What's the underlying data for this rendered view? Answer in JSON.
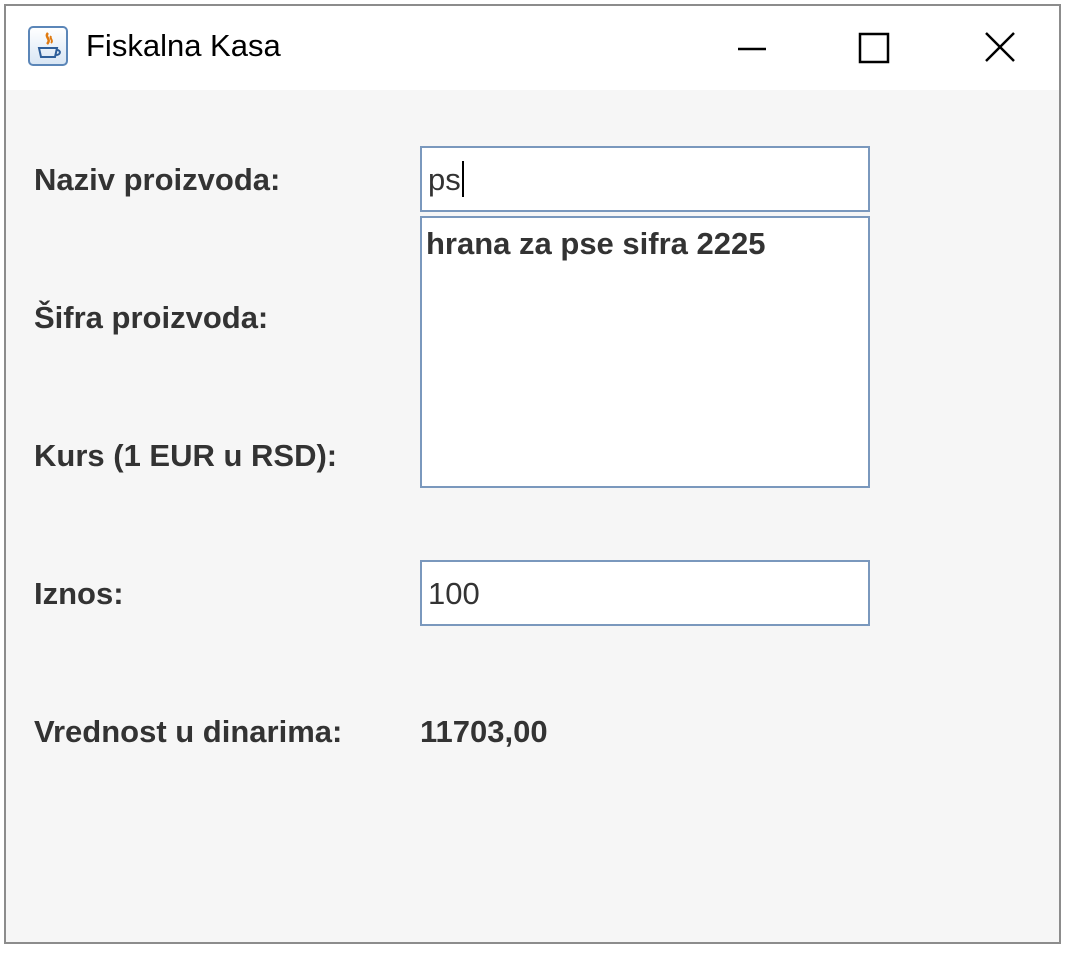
{
  "window": {
    "title": "Fiskalna Kasa",
    "icon": "java-cup-icon"
  },
  "controls": {
    "minimize": "minimize-icon",
    "maximize": "maximize-icon",
    "close": "close-icon"
  },
  "form": {
    "naziv_label": "Naziv proizvoda:",
    "naziv_value": "ps",
    "sifra_label": "Šifra proizvoda:",
    "kurs_label": "Kurs (1 EUR u RSD):",
    "suggestions": [
      "hrana za pse sifra 2225"
    ],
    "iznos_label": "Iznos:",
    "iznos_value": "100",
    "vrednost_label": "Vrednost u dinarima:",
    "vrednost_value": "11703,00"
  }
}
